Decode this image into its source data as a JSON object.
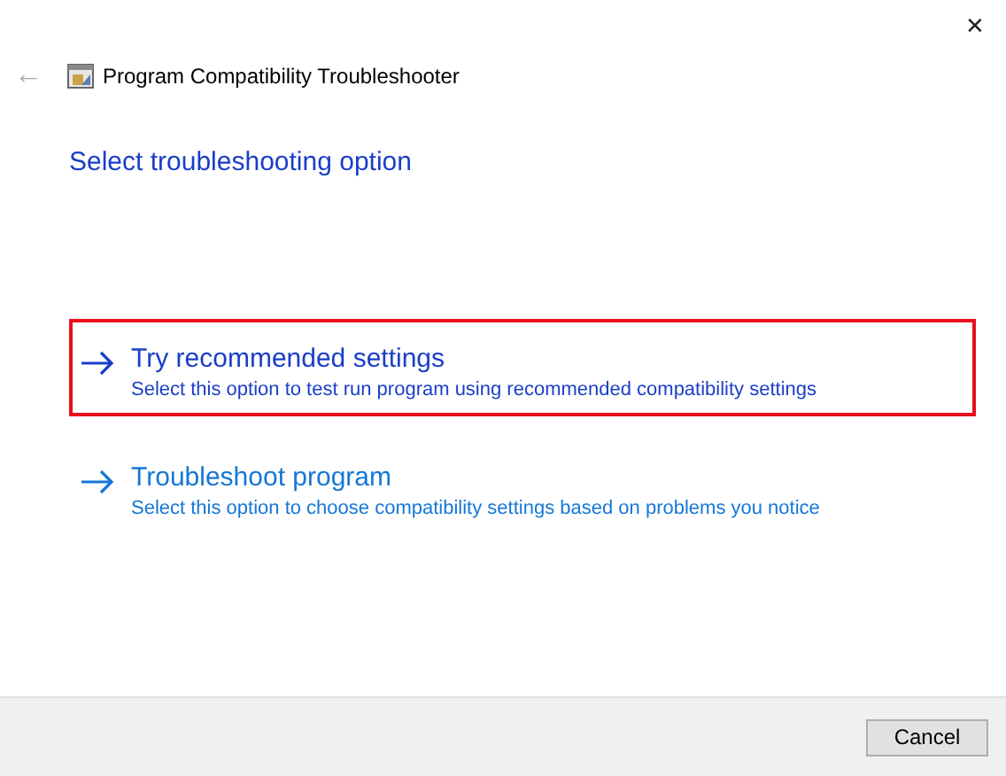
{
  "window": {
    "title": "Program Compatibility Troubleshooter",
    "close": "✕",
    "back": "←"
  },
  "heading": "Select troubleshooting option",
  "options": [
    {
      "title": "Try recommended settings",
      "description": "Select this option to test run program using recommended compatibility settings",
      "highlighted": true
    },
    {
      "title": "Troubleshoot program",
      "description": "Select this option to choose compatibility settings based on problems you notice",
      "highlighted": false
    }
  ],
  "buttons": [
    "Cancel"
  ]
}
